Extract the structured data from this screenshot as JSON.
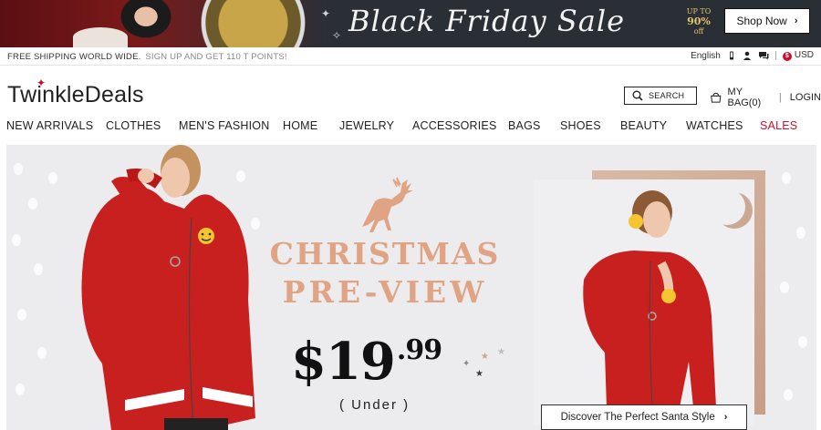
{
  "promo_banner": {
    "title": "Black Friday Sale",
    "up_to": "UP TO",
    "percent": "90%",
    "off": "off",
    "shop_button": "Shop Now",
    "chevron_icon": "chevron-right-icon"
  },
  "topbar": {
    "shipping_text": "FREE SHIPPING WORLD WIDE.",
    "signup_text": "SIGN UP AND GET 110 T POINTS!",
    "language": "English",
    "icons": [
      "phone-icon",
      "user-icon",
      "chat-icon"
    ],
    "currency_symbol": "$",
    "currency": "USD"
  },
  "header": {
    "logo": "TwinkleDeals",
    "search_label": "SEARCH",
    "bag_label": "MY BAG(0)",
    "login_label": "LOGIN"
  },
  "nav": {
    "items": [
      {
        "label": "NEW ARRIVALS"
      },
      {
        "label": "CLOTHES"
      },
      {
        "label": "MEN'S FASHION"
      },
      {
        "label": "HOME"
      },
      {
        "label": "JEWELRY"
      },
      {
        "label": "ACCESSORIES"
      },
      {
        "label": "BAGS"
      },
      {
        "label": "SHOES"
      },
      {
        "label": "BEAUTY"
      },
      {
        "label": "WATCHES"
      },
      {
        "label": "SALES"
      }
    ],
    "sale_color": "#c8102e"
  },
  "hero": {
    "headline_1": "CHRISTMAS",
    "headline_2": "PRE-VIEW",
    "price_dollars": "$19",
    "price_cents": ".99",
    "price_note": "( Under )",
    "cta": "Discover The Perfect Santa Style",
    "accent_color": "#e0a485",
    "sweater_color": "#c81f1f"
  }
}
